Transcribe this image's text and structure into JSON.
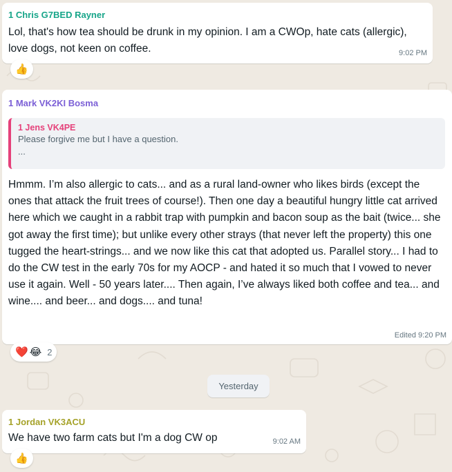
{
  "colors": {
    "background": "#efeae2",
    "sender_chris": "#17a589",
    "sender_mark": "#7b5fd6",
    "sender_jordan": "#a5a229",
    "quote_accent": "#e5417a"
  },
  "messages": [
    {
      "sender": "1 Chris G7BED Rayner",
      "text": "Lol, that's how tea should be drunk in my opinion. I am a CWOp, hate cats (allergic), love dogs, not keen on coffee.",
      "time": "9:02 PM",
      "reactions": [
        {
          "emoji": "👍",
          "icon": "thumbs-up-icon"
        }
      ],
      "reaction_count": ""
    },
    {
      "sender": "1 Mark VK2KI Bosma",
      "quote": {
        "sender": "1 Jens VK4PE",
        "text": "Please forgive me but I have a question.",
        "more": "..."
      },
      "text": "Hmmm. I’m also allergic to cats... and as a rural land-owner who likes birds (except the ones that attack the fruit trees of course!).  Then one day a beautiful hungry little cat arrived here which we caught in a rabbit trap with pumpkin and bacon soup as the bait (twice... she got away the first time);  but unlike every other strays (that never left the property) this one tugged the heart-strings... and we now like this cat that adopted us.  Parallel story... I had to do the CW test in the early 70s for my AOCP - and hated it so much that I vowed to never use it again.  Well - 50 years later.... Then again, I’ve always liked both coffee and tea... and wine.... and beer... and dogs.... and tuna!",
      "time": "Edited 9:20 PM",
      "reactions": [
        {
          "emoji": "❤️",
          "icon": "heart-icon"
        },
        {
          "emoji": "😂",
          "icon": "laughing-face-icon"
        }
      ],
      "reaction_count": "2"
    },
    {
      "sender": "1 Jordan VK3ACU",
      "text": "We have two farm cats but I'm a dog CW op",
      "time": "9:02 AM",
      "reactions": [
        {
          "emoji": "👍",
          "icon": "thumbs-up-icon"
        }
      ],
      "reaction_count": ""
    }
  ],
  "date_divider": "Yesterday"
}
